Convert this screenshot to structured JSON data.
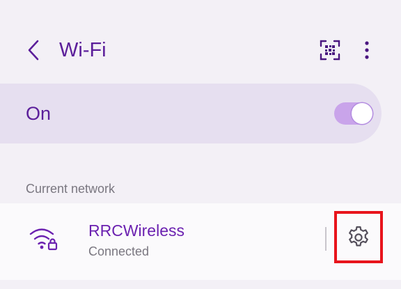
{
  "header": {
    "title": "Wi-Fi",
    "back_icon": "chevron-left-icon",
    "qr_icon": "qr-code-icon",
    "more_icon": "more-vertical-icon"
  },
  "wifi_toggle": {
    "label": "On",
    "state": true
  },
  "current_network": {
    "section_label": "Current network",
    "name": "RRCWireless",
    "status": "Connected",
    "icon": "wifi-locked-icon",
    "settings_icon": "gear-icon"
  },
  "colors": {
    "accent": "#5b1e9a",
    "highlight_box": "#e8141c",
    "switch_track": "#c9a4ea"
  }
}
